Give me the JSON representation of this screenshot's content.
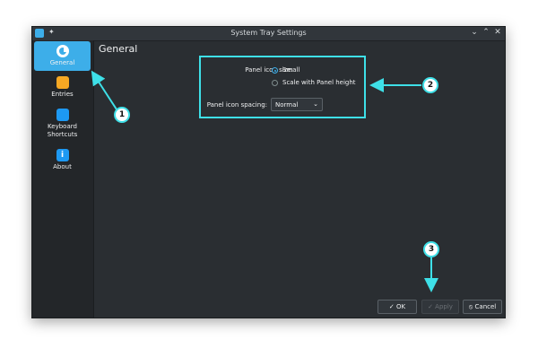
{
  "window": {
    "title": "System Tray Settings",
    "controls": [
      "minimize-icon",
      "maximize-icon",
      "close-icon"
    ]
  },
  "sidebar": {
    "items": [
      {
        "label": "General",
        "icon": "general-icon",
        "active": true
      },
      {
        "label": "Entries",
        "icon": "entries-icon",
        "active": false
      },
      {
        "label": "Keyboard Shortcuts",
        "icon": "keyboard-icon",
        "active": false
      },
      {
        "label": "About",
        "icon": "info-icon",
        "active": false
      }
    ]
  },
  "page": {
    "title": "General",
    "icon_size_label": "Panel icon size:",
    "icon_size_options": [
      {
        "label": "Small",
        "selected": true
      },
      {
        "label": "Scale with Panel height",
        "selected": false
      }
    ],
    "spacing_label": "Panel icon spacing:",
    "spacing_value": "Normal"
  },
  "buttons": {
    "ok": "OK",
    "apply": "Apply",
    "cancel": "Cancel"
  },
  "annotations": [
    "1",
    "2",
    "3"
  ],
  "colors": {
    "accent": "#3daee9",
    "annotation": "#3ee0e8",
    "window_bg": "#2a2e32"
  }
}
